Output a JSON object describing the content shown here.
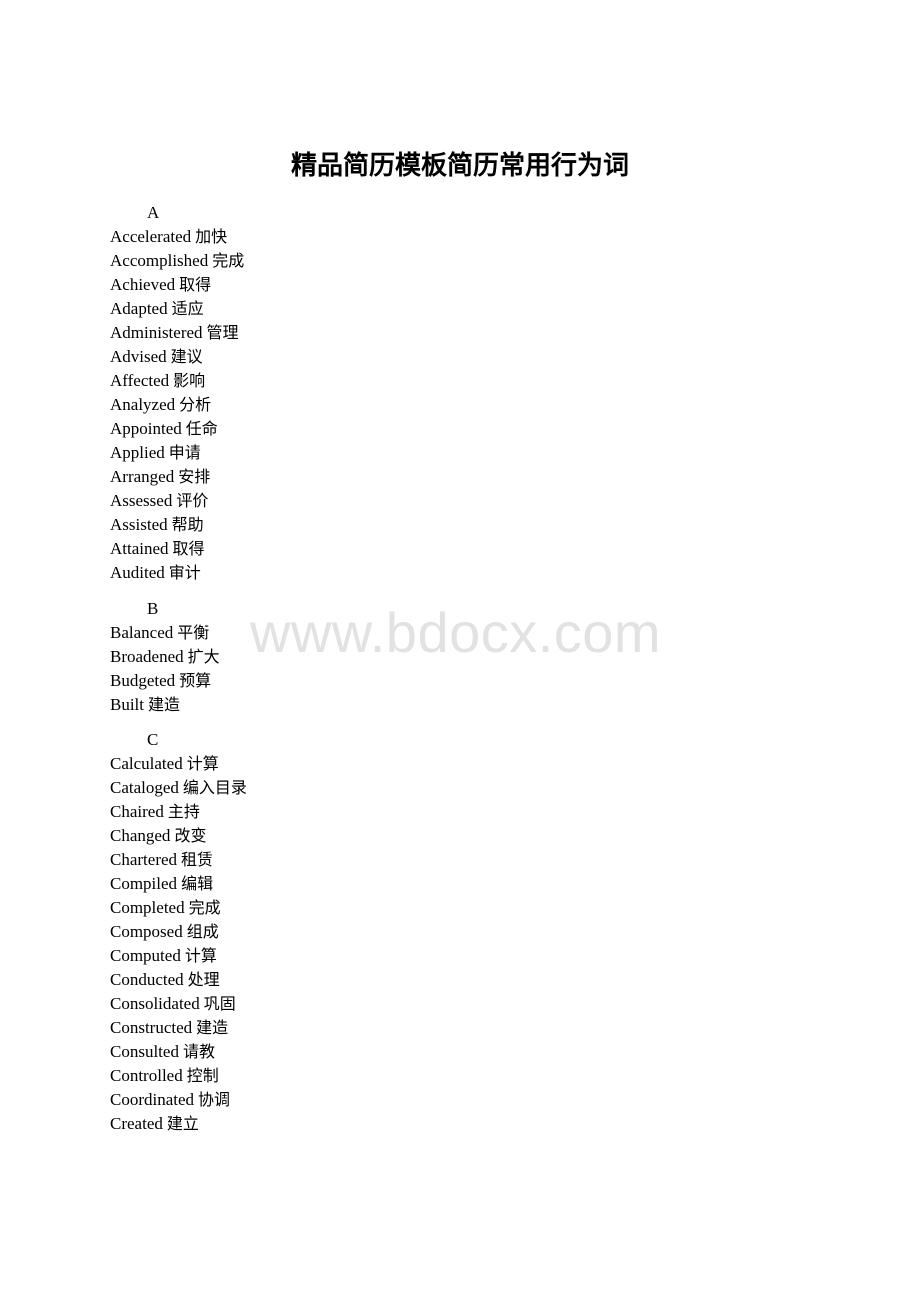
{
  "title": "精品简历模板简历常用行为词",
  "watermark": "www.bdocx.com",
  "sections": [
    {
      "letter": "A",
      "entries": [
        {
          "en": "Accelerated",
          "zh": "加快"
        },
        {
          "en": "Accomplished",
          "zh": "完成"
        },
        {
          "en": "Achieved",
          "zh": "取得"
        },
        {
          "en": "Adapted",
          "zh": "适应"
        },
        {
          "en": "Administered",
          "zh": "管理"
        },
        {
          "en": "Advised",
          "zh": "建议"
        },
        {
          "en": "Affected",
          "zh": "影响"
        },
        {
          "en": "Analyzed",
          "zh": "分析"
        },
        {
          "en": "Appointed",
          "zh": "任命"
        },
        {
          "en": "Applied",
          "zh": "申请"
        },
        {
          "en": "Arranged",
          "zh": "安排"
        },
        {
          "en": "Assessed",
          "zh": "评价"
        },
        {
          "en": "Assisted",
          "zh": "帮助"
        },
        {
          "en": "Attained",
          "zh": "取得"
        },
        {
          "en": "Audited",
          "zh": "审计"
        }
      ]
    },
    {
      "letter": "B",
      "entries": [
        {
          "en": "Balanced",
          "zh": "平衡"
        },
        {
          "en": "Broadened",
          "zh": "扩大"
        },
        {
          "en": "Budgeted",
          "zh": "预算"
        },
        {
          "en": "Built",
          "zh": "建造"
        }
      ]
    },
    {
      "letter": "C",
      "entries": [
        {
          "en": "Calculated",
          "zh": "计算"
        },
        {
          "en": "Cataloged",
          "zh": "编入目录"
        },
        {
          "en": "Chaired",
          "zh": "主持"
        },
        {
          "en": "Changed",
          "zh": "改变"
        },
        {
          "en": "Chartered",
          "zh": "租赁"
        },
        {
          "en": "Compiled",
          "zh": "编辑"
        },
        {
          "en": "Completed",
          "zh": "完成"
        },
        {
          "en": "Composed",
          "zh": "组成"
        },
        {
          "en": "Computed",
          "zh": "计算"
        },
        {
          "en": "Conducted",
          "zh": "处理"
        },
        {
          "en": "Consolidated",
          "zh": "巩固"
        },
        {
          "en": "Constructed",
          "zh": "建造"
        },
        {
          "en": "Consulted",
          "zh": "请教"
        },
        {
          "en": "Controlled",
          "zh": "控制"
        },
        {
          "en": "Coordinated",
          "zh": "协调"
        },
        {
          "en": "Created",
          "zh": "建立"
        }
      ]
    }
  ]
}
